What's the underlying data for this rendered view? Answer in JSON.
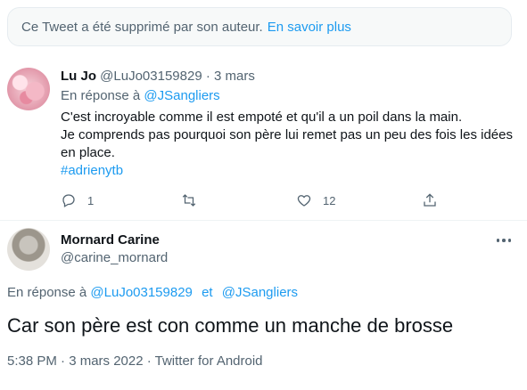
{
  "deleted_notice": {
    "text": "Ce Tweet a été supprimé par son auteur.",
    "link": "En savoir plus"
  },
  "reply": {
    "name": "Lu Jo",
    "handle": "@LuJo03159829",
    "separator": "·",
    "date": "3 mars",
    "replying_prefix": "En réponse à",
    "replying_to": "@JSangliers",
    "lines": [
      "C'est incroyable comme il est empoté et qu'il a un poil dans la main.",
      "Je comprends pas pourquoi son père lui remet pas un peu des fois les idées",
      "en place."
    ],
    "hashtag": "#adrienytb",
    "actions": {
      "reply_count": "1",
      "retweet_count": "",
      "like_count": "12"
    }
  },
  "main": {
    "name": "Mornard Carine",
    "handle": "@carine_mornard",
    "replying_prefix": "En réponse à",
    "replying_to_1": "@LuJo03159829",
    "replying_and": "et",
    "replying_to_2": "@JSangliers",
    "text": "Car son père est con comme un manche de brosse",
    "meta": "5:38 PM · 3 mars 2022 · Twitter for Android"
  },
  "colors": {
    "accent": "#1d9bf0",
    "secondary_text": "#536471",
    "primary_text": "#0f1419"
  }
}
